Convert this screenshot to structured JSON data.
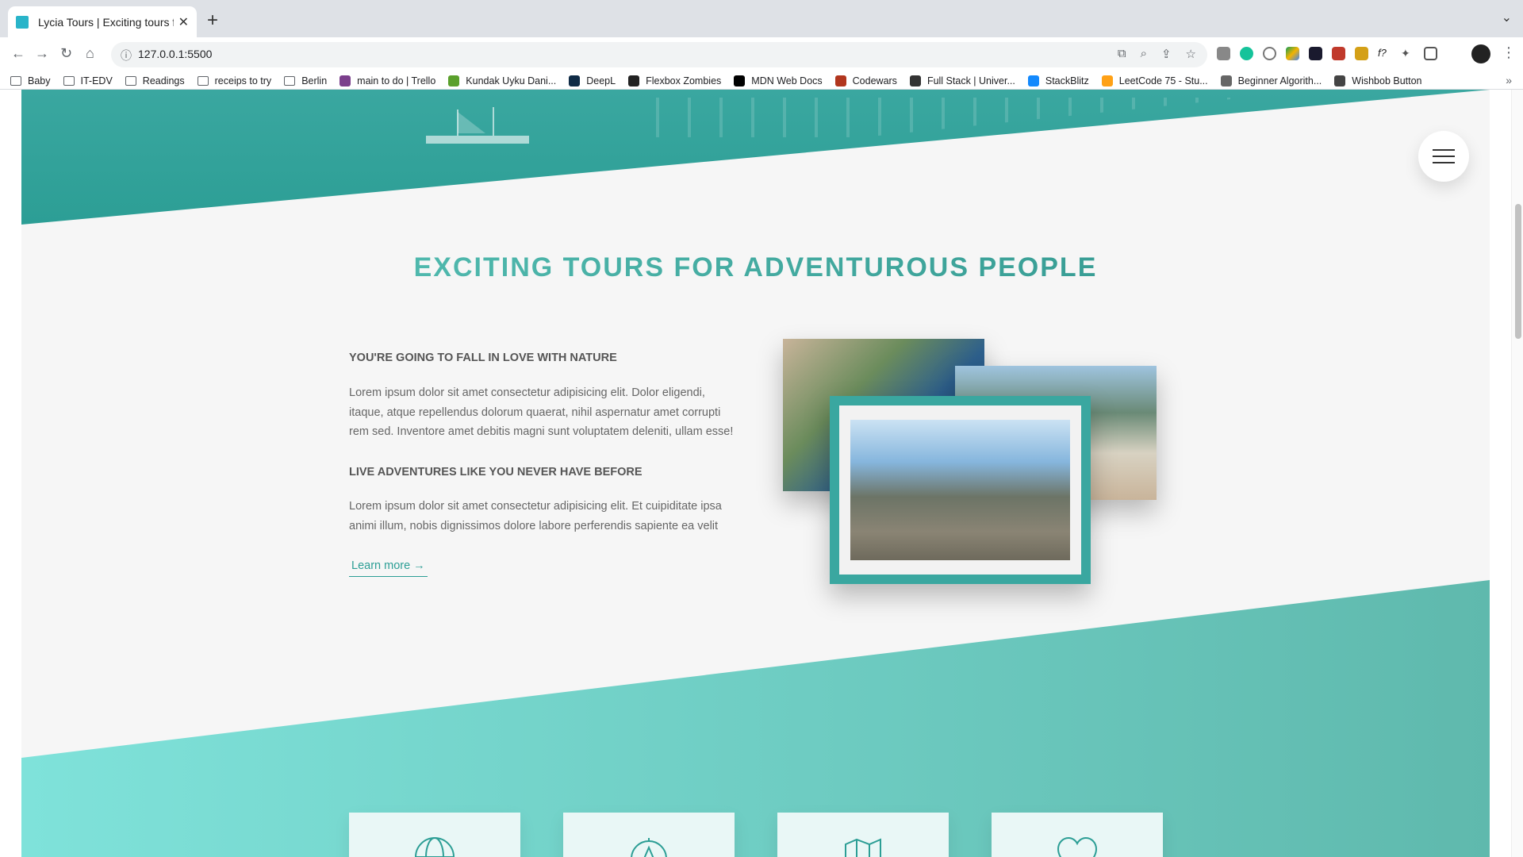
{
  "browser": {
    "tab_title": "Lycia Tours | Exciting tours for",
    "url": "127.0.0.1:5500",
    "bookmarks": [
      {
        "label": "Baby",
        "type": "folder"
      },
      {
        "label": "IT-EDV",
        "type": "folder"
      },
      {
        "label": "Readings",
        "type": "folder"
      },
      {
        "label": "receips to try",
        "type": "folder"
      },
      {
        "label": "Berlin",
        "type": "folder"
      },
      {
        "label": "main to do | Trello",
        "type": "site",
        "color": "#7b3f8c"
      },
      {
        "label": "Kundak Uyku Dani...",
        "type": "site",
        "color": "#5aa02c"
      },
      {
        "label": "DeepL",
        "type": "site",
        "color": "#0f2b46"
      },
      {
        "label": "Flexbox Zombies",
        "type": "site",
        "color": "#222222"
      },
      {
        "label": "MDN Web Docs",
        "type": "site",
        "color": "#000000"
      },
      {
        "label": "Codewars",
        "type": "site",
        "color": "#b1361e"
      },
      {
        "label": "Full Stack | Univer...",
        "type": "site",
        "color": "#333333"
      },
      {
        "label": "StackBlitz",
        "type": "site",
        "color": "#1389fd"
      },
      {
        "label": "LeetCode 75 - Stu...",
        "type": "site",
        "color": "#ffa116"
      },
      {
        "label": "Beginner Algorith...",
        "type": "site",
        "color": "#666666"
      },
      {
        "label": "Wishbob Button",
        "type": "site",
        "color": "#444444"
      }
    ]
  },
  "page": {
    "section_title_part1": "EXCITING TOURS FOR ADVENTUROUS PEOPLE",
    "block1_heading": "YOU'RE GOING TO FALL IN LOVE WITH NATURE",
    "block1_text": "Lorem ipsum dolor sit amet consectetur adipisicing elit. Dolor eligendi, itaque, atque repellendus dolorum quaerat, nihil aspernatur amet corrupti rem sed. Inventore amet debitis magni sunt voluptatem deleniti, ullam esse!",
    "block2_heading": "LIVE ADVENTURES LIKE YOU NEVER HAVE BEFORE",
    "block2_text": "Lorem ipsum dolor sit amet consectetur adipisicing elit. Et cuipiditate ipsa animi illum, nobis dignissimos dolore labore perferendis sapiente ea velit",
    "learn_more": "Learn more →",
    "cards": [
      {
        "icon": "globe-icon"
      },
      {
        "icon": "compass-icon"
      },
      {
        "icon": "map-icon"
      },
      {
        "icon": "heart-icon"
      }
    ]
  },
  "colors": {
    "accent": "#2c9e95",
    "accent_light": "#7fe2da"
  }
}
